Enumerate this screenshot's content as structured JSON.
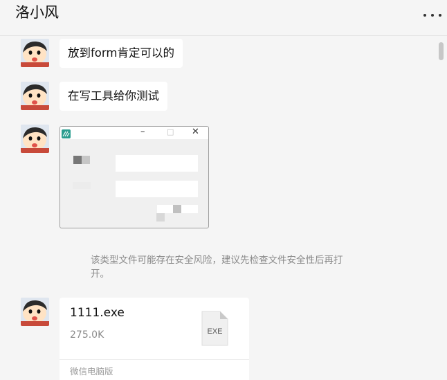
{
  "header": {
    "title": "洛小风",
    "more_icon": "more-icon"
  },
  "messages": [
    {
      "type": "text",
      "text": "放到form肯定可以的"
    },
    {
      "type": "text",
      "text": "在写工具给你测试"
    },
    {
      "type": "image",
      "window_controls": [
        "–",
        "□",
        "✕"
      ]
    },
    {
      "type": "warning",
      "text": "该类型文件可能存在安全风险，建议先检查文件安全性后再打开。"
    },
    {
      "type": "file",
      "name": "1111.exe",
      "size": "275.0K",
      "icon_label": "EXE",
      "source": "微信电脑版"
    }
  ],
  "colors": {
    "background": "#f5f5f5",
    "bubble": "#ffffff",
    "muted_text": "#8a8a8a"
  }
}
